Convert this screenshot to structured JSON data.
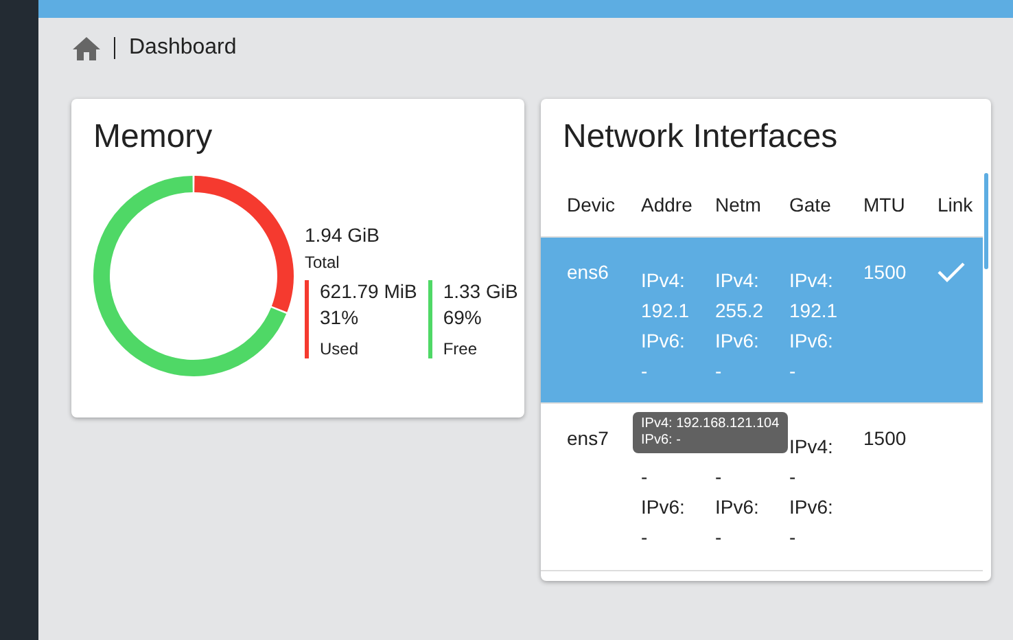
{
  "breadcrumb": {
    "current": "Dashboard"
  },
  "memory": {
    "title": "Memory",
    "total": {
      "value": "1.94 GiB",
      "label": "Total"
    },
    "legend": [
      {
        "value": "621.79 MiB",
        "percent": "31%",
        "color": "#f53a2f"
      },
      {
        "value": "1.33 GiB",
        "percent": "69%",
        "color": "#4fd866"
      }
    ],
    "chart_data": {
      "type": "donut",
      "categories": [
        "Used",
        "Free"
      ],
      "values": [
        31,
        69
      ]
    }
  },
  "network": {
    "title": "Network Interfaces",
    "columns": [
      "Devic",
      "Addre",
      "Netm",
      "Gate",
      "MTU",
      "Link"
    ],
    "rows": [
      {
        "device": "ens6",
        "selected": true,
        "address": [
          "IPv4:",
          "192.1",
          "IPv6:",
          "-"
        ],
        "netmask": [
          "IPv4:",
          "255.2",
          "IPv6:",
          "-"
        ],
        "gateway": [
          "IPv4:",
          "192.1",
          "IPv6:",
          "-"
        ],
        "mtu": "1500",
        "linked": true
      },
      {
        "device": "ens7",
        "selected": false,
        "address": [
          "-",
          "IPv6:",
          "-"
        ],
        "netmask": [
          "-",
          "IPv6:",
          "-"
        ],
        "gateway": [
          "IPv4:",
          "-",
          "IPv6:",
          "-"
        ],
        "mtu": "1500",
        "linked": false
      }
    ],
    "tooltip": [
      "IPv4: 192.168.121.104",
      "IPv6: -"
    ]
  }
}
